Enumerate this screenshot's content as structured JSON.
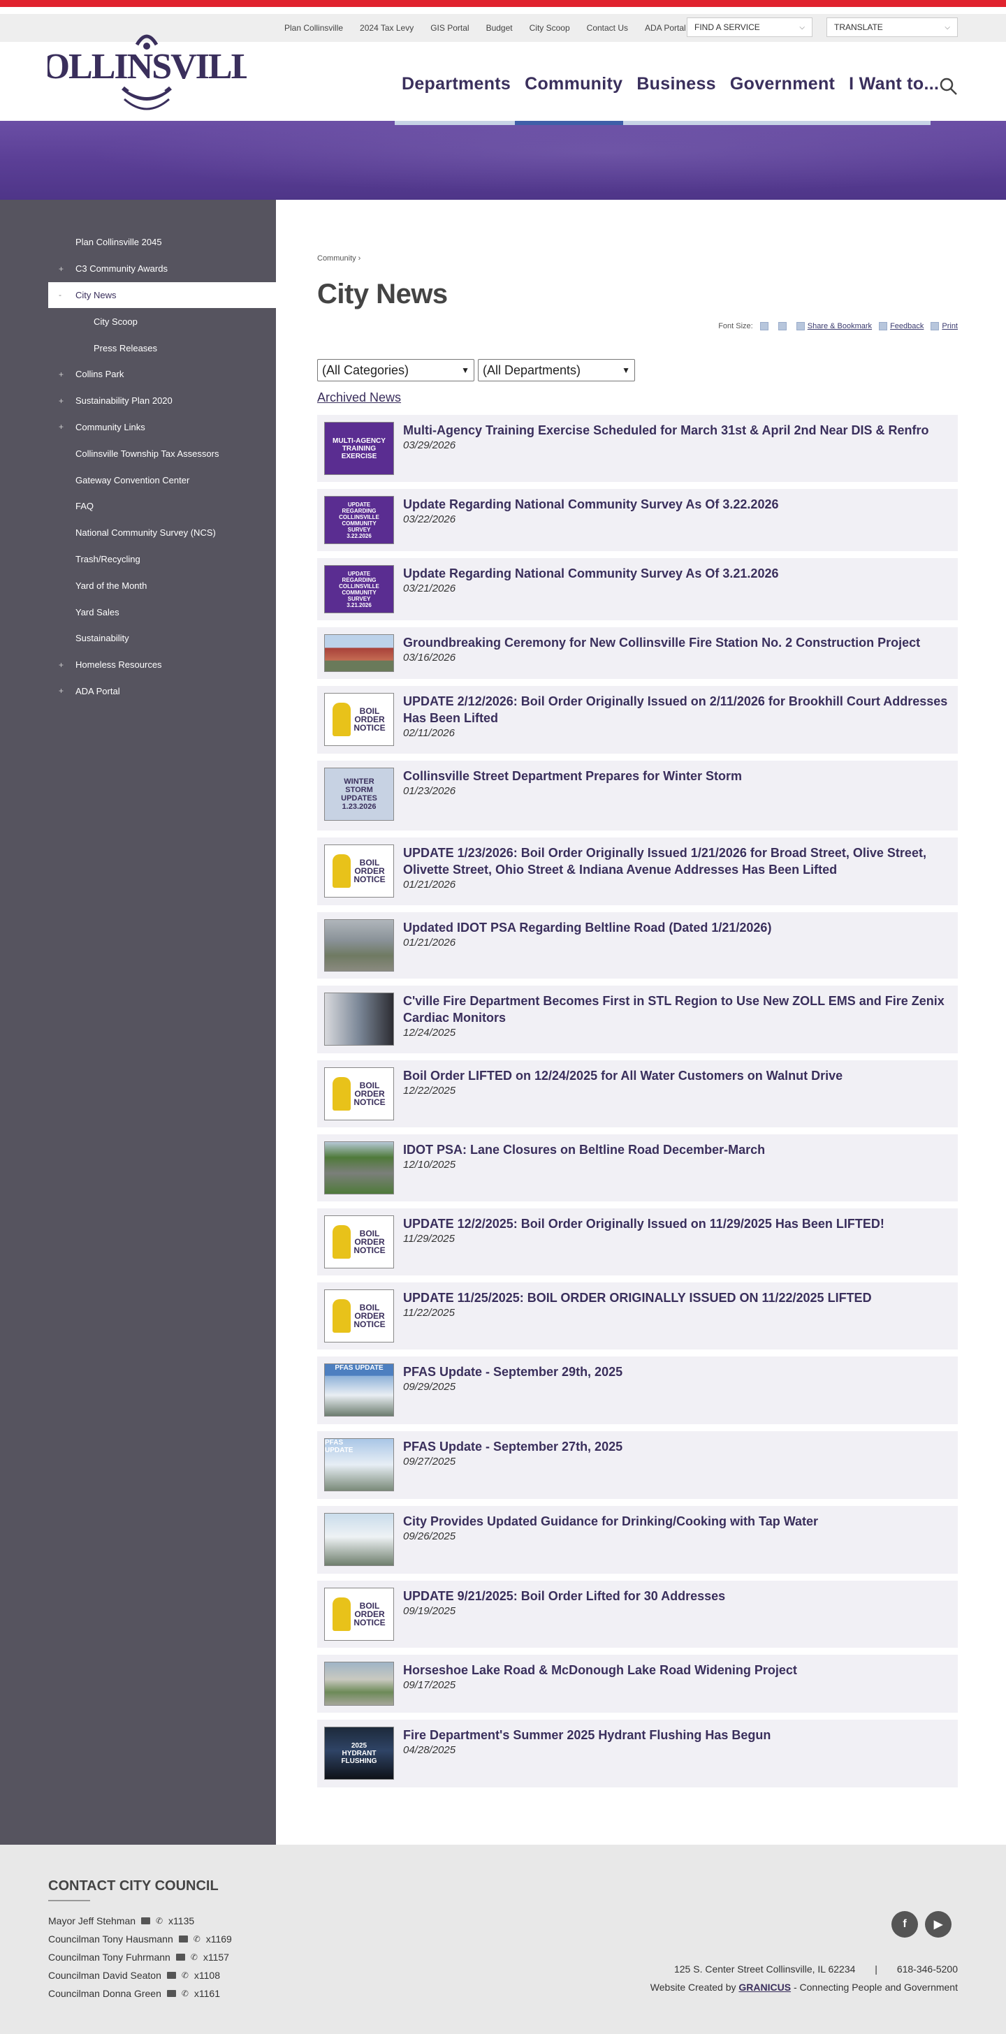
{
  "utility": {
    "links": [
      "Plan Collinsville",
      "2024 Tax Levy",
      "GIS Portal",
      "Budget",
      "City Scoop",
      "Contact Us",
      "ADA Portal"
    ],
    "find_service": "FIND A SERVICE",
    "translate": "TRANSLATE"
  },
  "logo_text": "COLLINSVILLE",
  "nav": [
    "Departments",
    "Community",
    "Business",
    "Government",
    "I Want to..."
  ],
  "sidebar": [
    {
      "label": "Plan Collinsville 2045",
      "expander": ""
    },
    {
      "label": "C3 Community Awards",
      "expander": "+"
    },
    {
      "label": "City News",
      "expander": "-",
      "active": true
    },
    {
      "label": "City Scoop",
      "expander": "",
      "sub": true
    },
    {
      "label": "Press Releases",
      "expander": "",
      "sub": true
    },
    {
      "label": "Collins Park",
      "expander": "+"
    },
    {
      "label": "Sustainability Plan 2020",
      "expander": "+"
    },
    {
      "label": "Community Links",
      "expander": "+"
    },
    {
      "label": "Collinsville Township Tax Assessors",
      "expander": ""
    },
    {
      "label": "Gateway Convention Center",
      "expander": ""
    },
    {
      "label": "FAQ",
      "expander": ""
    },
    {
      "label": "National Community Survey (NCS)",
      "expander": ""
    },
    {
      "label": "Trash/Recycling",
      "expander": ""
    },
    {
      "label": "Yard of the Month",
      "expander": ""
    },
    {
      "label": "Yard Sales",
      "expander": ""
    },
    {
      "label": "Sustainability",
      "expander": ""
    },
    {
      "label": "Homeless Resources",
      "expander": "+"
    },
    {
      "label": "ADA Portal",
      "expander": "+"
    }
  ],
  "breadcrumb": "Community ›",
  "page_title": "City News",
  "tools": {
    "font_size": "Font Size:",
    "share": "Share & Bookmark",
    "feedback": "Feedback",
    "print": "Print"
  },
  "filters": {
    "categories": "(All Categories)",
    "departments": "(All Departments)"
  },
  "archived": "Archived News",
  "news": [
    {
      "title": "Multi-Agency Training Exercise Scheduled for March 31st & April 2nd Near DIS & Renfro",
      "date": "03/29/2026",
      "thumb": "training",
      "thumb_text": [
        "MULTI-AGENCY",
        "TRAINING",
        "EXERCISE"
      ]
    },
    {
      "title": "Update Regarding National Community Survey As Of 3.22.2026",
      "date": "03/22/2026",
      "thumb": "survey",
      "thumb_text": [
        "UPDATE",
        "REGARDING",
        "COLLINSVILLE",
        "COMMUNITY",
        "SURVEY",
        "3.22.2026"
      ]
    },
    {
      "title": "Update Regarding National Community Survey As Of 3.21.2026",
      "date": "03/21/2026",
      "thumb": "survey",
      "thumb_text": [
        "UPDATE",
        "REGARDING",
        "COLLINSVILLE",
        "COMMUNITY",
        "SURVEY",
        "3.21.2026"
      ]
    },
    {
      "title": "Groundbreaking Ceremony for New Collinsville Fire Station No. 2 Construction Project",
      "date": "03/16/2026",
      "thumb": "building",
      "thumb_text": []
    },
    {
      "title": "UPDATE 2/12/2026: Boil Order Originally Issued on 2/11/2026 for Brookhill Court Addresses Has Been Lifted",
      "date": "02/11/2026",
      "thumb": "boil",
      "thumb_text": [
        "BOIL",
        "ORDER",
        "NOTICE"
      ]
    },
    {
      "title": "Collinsville Street Department Prepares for Winter Storm",
      "date": "01/23/2026",
      "thumb": "winter",
      "thumb_text": [
        "WINTER",
        "STORM",
        "UPDATES",
        "1.23.2026"
      ]
    },
    {
      "title": "UPDATE 1/23/2026: Boil Order Originally Issued 1/21/2026 for Broad Street, Olive Street, Olivette Street, Ohio Street & Indiana Avenue Addresses Has Been Lifted",
      "date": "01/21/2026",
      "thumb": "boil",
      "thumb_text": [
        "BOIL",
        "ORDER",
        "NOTICE"
      ]
    },
    {
      "title": "Updated IDOT PSA Regarding Beltline Road (Dated 1/21/2026)",
      "date": "01/21/2026",
      "thumb": "aerial",
      "thumb_text": []
    },
    {
      "title": "C'ville Fire Department Becomes First in STL Region to Use New ZOLL EMS and Fire Zenix Cardiac Monitors",
      "date": "12/24/2025",
      "thumb": "photo",
      "thumb_text": []
    },
    {
      "title": "Boil Order LIFTED on 12/24/2025 for All Water Customers on Walnut Drive",
      "date": "12/22/2025",
      "thumb": "boil",
      "thumb_text": [
        "BOIL",
        "ORDER",
        "NOTICE"
      ]
    },
    {
      "title": "IDOT PSA: Lane Closures on Beltline Road December-March",
      "date": "12/10/2025",
      "thumb": "road",
      "thumb_text": []
    },
    {
      "title": "UPDATE 12/2/2025: Boil Order Originally Issued on 11/29/2025 Has Been LIFTED!",
      "date": "11/29/2025",
      "thumb": "boil",
      "thumb_text": [
        "BOIL",
        "ORDER",
        "NOTICE"
      ]
    },
    {
      "title": "UPDATE 11/25/2025: BOIL ORDER ORIGINALLY ISSUED ON 11/22/2025 LIFTED",
      "date": "11/22/2025",
      "thumb": "boil",
      "thumb_text": [
        "BOIL",
        "ORDER",
        "NOTICE"
      ]
    },
    {
      "title": "PFAS Update - September 29th, 2025",
      "date": "09/29/2025",
      "thumb": "pfas",
      "thumb_text": [
        "PFAS UPDATE"
      ]
    },
    {
      "title": "PFAS Update - September 27th, 2025",
      "date": "09/27/2025",
      "thumb": "pfas2",
      "thumb_text": [
        "PFAS",
        "UPDATE"
      ]
    },
    {
      "title": "City Provides Updated Guidance for Drinking/Cooking with Tap Water",
      "date": "09/26/2025",
      "thumb": "tower",
      "thumb_text": []
    },
    {
      "title": "UPDATE 9/21/2025: Boil Order Lifted for 30 Addresses",
      "date": "09/19/2025",
      "thumb": "boil",
      "thumb_text": [
        "BOIL",
        "ORDER",
        "NOTICE"
      ]
    },
    {
      "title": "Horseshoe Lake Road & McDonough Lake Road Widening Project",
      "date": "09/17/2025",
      "thumb": "aerial2",
      "thumb_text": []
    },
    {
      "title": "Fire Department's Summer 2025 Hydrant Flushing Has Begun",
      "date": "04/28/2025",
      "thumb": "hydrant",
      "thumb_text": [
        "2025",
        "HYDRANT",
        "FLUSHING"
      ]
    }
  ],
  "footer": {
    "heading": "CONTACT CITY COUNCIL",
    "council": [
      {
        "name": "Mayor Jeff Stehman",
        "ext": "x1135"
      },
      {
        "name": "Councilman Tony Hausmann",
        "ext": "x1169"
      },
      {
        "name": "Councilman Tony Fuhrmann",
        "ext": "x1157"
      },
      {
        "name": "Councilman David Seaton",
        "ext": "x1108"
      },
      {
        "name": "Councilman Donna Green",
        "ext": "x1161"
      }
    ],
    "address": "125 S. Center Street Collinsville, IL 62234",
    "separator": "|",
    "phone": "618-346-5200",
    "credit_prefix": "Website Created by",
    "credit_brand": "GRANICUS",
    "credit_suffix": "- Connecting People and Government",
    "social": [
      "facebook-icon",
      "youtube-icon"
    ]
  },
  "colors": {
    "accent": "#3a2f5c",
    "sidebar": "#56545f",
    "topstrip": "#e0232e",
    "hero": "#5b3f96"
  }
}
